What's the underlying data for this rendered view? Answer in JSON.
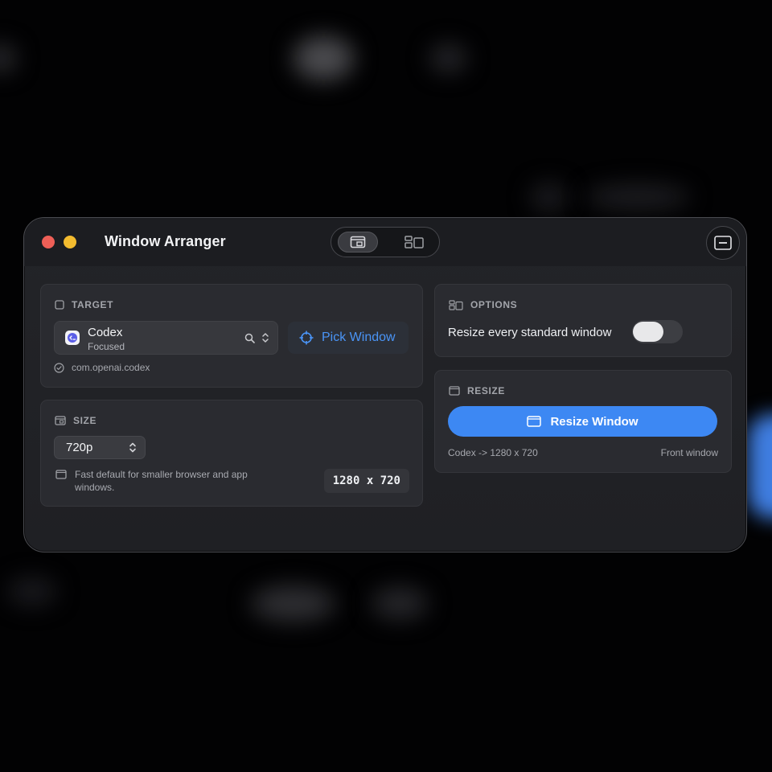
{
  "window": {
    "title": "Window Arranger"
  },
  "toolbar": {
    "segments": [
      {
        "icon": "single-window-layout-icon",
        "active": true
      },
      {
        "icon": "multi-window-layout-icon",
        "active": false
      }
    ],
    "collapse_icon": "minimize-panel-icon"
  },
  "target": {
    "header": "TARGET",
    "app_name": "Codex",
    "app_status": "Focused",
    "pick_label": "Pick Window",
    "bundle_id": "com.openai.codex"
  },
  "size": {
    "header": "SIZE",
    "selected": "720p",
    "description": "Fast default for smaller browser and app windows.",
    "dimensions": "1280 x 720"
  },
  "options": {
    "header": "OPTIONS",
    "resize_all_label": "Resize every standard window",
    "resize_all_on": false
  },
  "resize": {
    "header": "RESIZE",
    "button_label": "Resize Window",
    "summary": "Codex -> 1280 x 720",
    "scope": "Front window"
  },
  "colors": {
    "accent": "#3d88f3",
    "link": "#4a95f7",
    "close": "#ee5f57",
    "minimize": "#f3bb2f"
  }
}
